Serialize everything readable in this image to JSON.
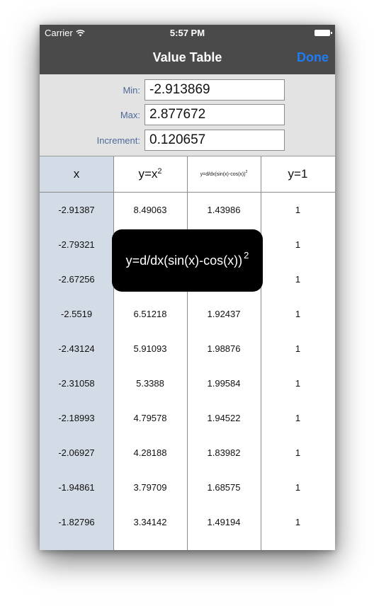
{
  "status": {
    "carrier": "Carrier",
    "time": "5:57 PM"
  },
  "nav": {
    "title": "Value Table",
    "done_label": "Done"
  },
  "form": {
    "min_label": "Min:",
    "min_value": "-2.913869",
    "max_label": "Max:",
    "max_value": "2.877672",
    "increment_label": "Increment:",
    "increment_value": "0.120657"
  },
  "table": {
    "headers": {
      "x": "x",
      "f1": "y=x",
      "f1_sup": "2",
      "f2": "y=d/dx(sin(x)-cos(x))",
      "f2_sup": "2",
      "f3": "y=1"
    },
    "rows": [
      {
        "x": "-2.91387",
        "f1": "8.49063",
        "f2": "1.43986",
        "f3": "1"
      },
      {
        "x": "-2.79321",
        "f1": "",
        "f2": "",
        "f3": "1"
      },
      {
        "x": "-2.67256",
        "f1": "",
        "f2": "",
        "f3": "1"
      },
      {
        "x": "-2.5519",
        "f1": "6.51218",
        "f2": "1.92437",
        "f3": "1"
      },
      {
        "x": "-2.43124",
        "f1": "5.91093",
        "f2": "1.98876",
        "f3": "1"
      },
      {
        "x": "-2.31058",
        "f1": "5.3388",
        "f2": "1.99584",
        "f3": "1"
      },
      {
        "x": "-2.18993",
        "f1": "4.79578",
        "f2": "1.94522",
        "f3": "1"
      },
      {
        "x": "-2.06927",
        "f1": "4.28188",
        "f2": "1.83982",
        "f3": "1"
      },
      {
        "x": "-1.94861",
        "f1": "3.79709",
        "f2": "1.68575",
        "f3": "1"
      },
      {
        "x": "-1.82796",
        "f1": "3.34142",
        "f2": "1.49194",
        "f3": "1"
      }
    ]
  },
  "overlay": {
    "text": "y=d/dx(sin(x)-cos(x))",
    "sup": "2"
  },
  "colors": {
    "nav_bg": "#4a4a4a",
    "accent": "#1e7cf5",
    "x_column": "#d3dbe6",
    "label": "#4e6a98"
  }
}
